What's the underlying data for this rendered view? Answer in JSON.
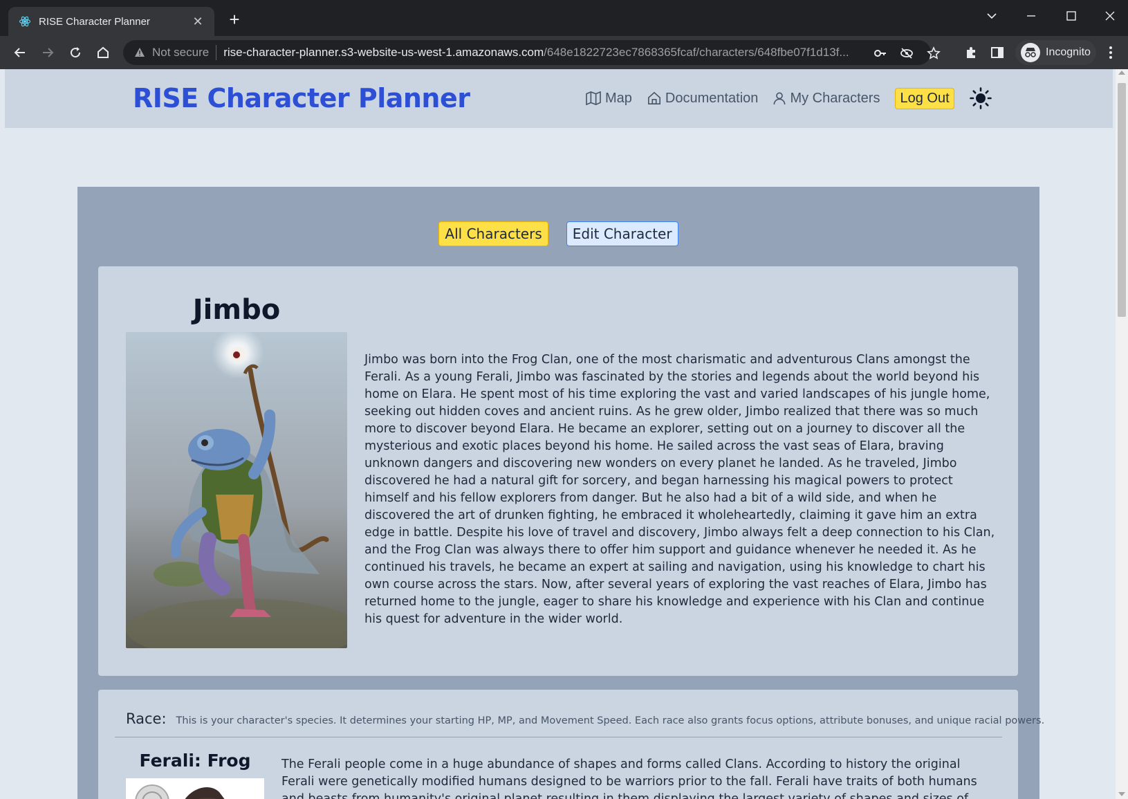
{
  "browser": {
    "tab_title": "RISE Character Planner",
    "security_label": "Not secure",
    "url_host": "rise-character-planner.s3-website-us-west-1.amazonaws.com",
    "url_path": "/648e1822723ec7868365fcaf/characters/648fbe07f1d13f...",
    "profile_label": "Incognito"
  },
  "site": {
    "brand": "RISE Character Planner",
    "nav": {
      "map": "Map",
      "documentation": "Documentation",
      "my_characters": "My Characters",
      "logout": "Log Out"
    },
    "accent_color": "#2c4fd6"
  },
  "actions": {
    "all_characters": "All Characters",
    "edit_character": "Edit Character"
  },
  "character": {
    "name": "Jimbo",
    "backstory": "Jimbo was born into the Frog Clan, one of the most charismatic and adventurous Clans amongst the Ferali. As a young Ferali, Jimbo was fascinated by the stories and legends about the world beyond his home on Elara. He spent most of his time exploring the vast and varied landscapes of his jungle home, seeking out hidden coves and ancient ruins. As he grew older, Jimbo realized that there was so much more to discover beyond Elara. He became an explorer, setting out on a journey to discover all the mysterious and exotic places beyond his home. He sailed across the vast seas of Elara, braving unknown dangers and discovering new wonders on every planet he landed. As he traveled, Jimbo discovered he had a natural gift for sorcery, and began harnessing his magical powers to protect himself and his fellow explorers from danger. But he also had a bit of a wild side, and when he discovered the art of drunken fighting, he embraced it wholeheartedly, claiming it gave him an extra edge in battle. Despite his love of travel and discovery, Jimbo always felt a deep connection to his Clan, and the Frog Clan was always there to offer him support and guidance whenever he needed it. As he continued his travels, he became an expert at sailing and navigation, using his knowledge to chart his own course across the stars. Now, after several years of exploring the vast reaches of Elara, Jimbo has returned home to the jungle, eager to share his knowledge and experience with his Clan and continue his quest for adventure in the wider world."
  },
  "race": {
    "label": "Race:",
    "hint": "This is your character's species. It determines your starting HP, MP, and Movement Speed. Each race also grants focus options, attribute bonuses, and unique racial powers.",
    "name": "Ferali: Frog",
    "description": "The Ferali people come in a huge abundance of shapes and forms called Clans. According to history the original Ferali were genetically modified humans designed to be warriors prior to the fall. Ferali have traits of both humans and beasts from humanity's original planet resulting in them displaying the largest variety of shapes and sizes of any race. Depending on Clan and animal"
  },
  "icons": {
    "favicon": "react-atom-icon",
    "map": "map-icon",
    "documentation": "home-icon",
    "my_characters": "user-icon",
    "theme": "sun-icon"
  }
}
